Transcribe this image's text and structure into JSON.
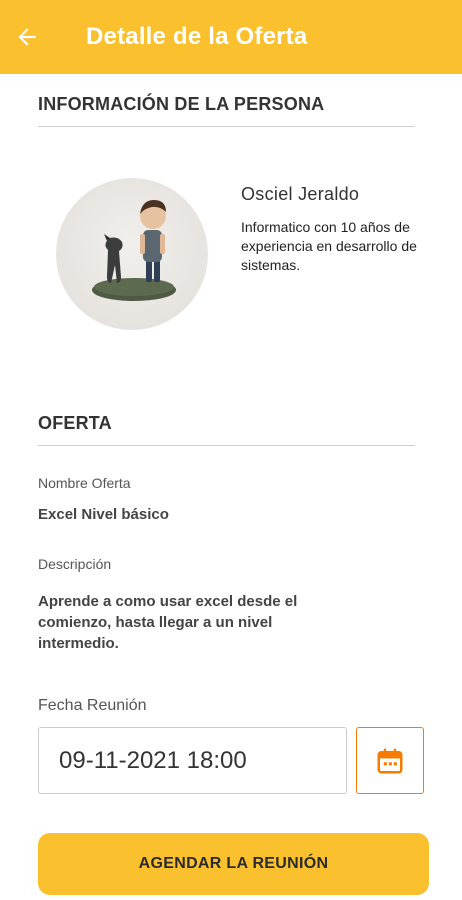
{
  "header": {
    "title": "Detalle de la Oferta",
    "back_icon": "arrow-left-icon",
    "color": "#FBC02D"
  },
  "person_section": {
    "title": "INFORMACIÓN DE LA PERSONA",
    "name": "Osciel Jeraldo",
    "description": "Informatico con 10 años de experiencia en desarrollo de sistemas."
  },
  "offer_section": {
    "title": "OFERTA",
    "name_label": "Nombre Oferta",
    "name_value": "Excel Nivel básico",
    "description_label": "Descripción",
    "description_value": "Aprende a como usar excel desde el comienzo, hasta llegar a un nivel intermedio."
  },
  "meeting": {
    "date_label": "Fecha Reunión",
    "date_value": "09-11-2021 18:00",
    "calendar_icon": "calendar-icon",
    "accent_color": "#F57C00"
  },
  "actions": {
    "schedule_label": "AGENDAR LA REUNIÓN"
  }
}
